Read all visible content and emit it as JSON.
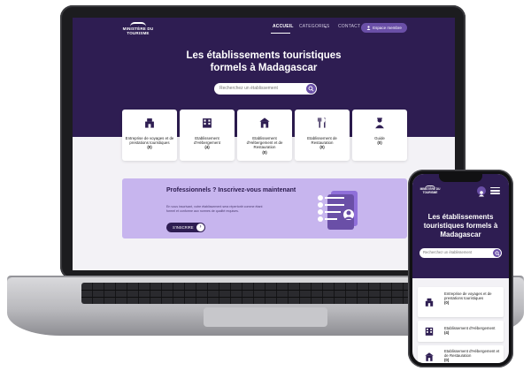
{
  "brand": {
    "logo_line1": "MINISTÈRE DU",
    "logo_line2": "TOURISME"
  },
  "nav": {
    "items": [
      {
        "label": "ACCUEIL"
      },
      {
        "label": "CATEGORIES"
      },
      {
        "label": "CONTACT"
      }
    ],
    "member_button": "Espace membre"
  },
  "hero": {
    "title": "Les établissements touristiques formels à Madagascar",
    "search_placeholder": "Recherchez un établissement"
  },
  "categories": [
    {
      "icon": "shop-icon",
      "label": "Entreprise de voyages et de prestations touristiques",
      "count": "(0)"
    },
    {
      "icon": "building-icon",
      "label": "Etablissement d'Hébergement",
      "count": "(4)"
    },
    {
      "icon": "hotel-icon",
      "label": "Etablissement d'Hébergement et de Restauration",
      "count": "(0)"
    },
    {
      "icon": "restaurant-icon",
      "label": "Etablissement de Restauration",
      "count": "(0)"
    },
    {
      "icon": "guide-icon",
      "label": "Guide",
      "count": "(0)"
    }
  ],
  "pro": {
    "title": "Professionnels ? Inscrivez-vous maintenant",
    "text": "En vous inscrivant, votre établissement sera répertorié comme étant formel et conforme aux normes de qualité requises.",
    "button": "S'INSCRIRE"
  },
  "mobile": {
    "title": "Les établissements touristiques formels à Madagascar",
    "search_placeholder": "Recherchez un établissement",
    "cards": [
      {
        "label": "Entreprise de voyages et de prestations touristiques",
        "count": "(0)"
      },
      {
        "label": "Etablissement d'Hébergement",
        "count": "(4)"
      },
      {
        "label": "Etablissement d'Hébergement et de Restauration",
        "count": "(0)"
      }
    ]
  },
  "colors": {
    "primary_dark": "#2e1d52",
    "accent": "#6a4fa7",
    "banner": "#c7b5ee",
    "background": "#f3f2f6"
  }
}
